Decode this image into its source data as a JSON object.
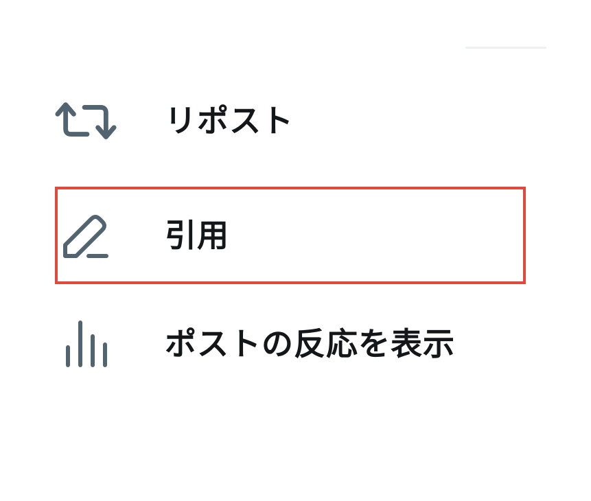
{
  "menu": {
    "items": [
      {
        "label": "リポスト",
        "icon": "repost-icon"
      },
      {
        "label": "引用",
        "icon": "pencil-icon",
        "highlighted": true,
        "highlight_color": "#e04a3c"
      },
      {
        "label": "ポストの反応を表示",
        "icon": "bar-chart-icon"
      }
    ]
  },
  "colors": {
    "icon": "#536471",
    "text": "#14171a",
    "highlight_border": "#e04a3c",
    "background": "#ffffff"
  }
}
